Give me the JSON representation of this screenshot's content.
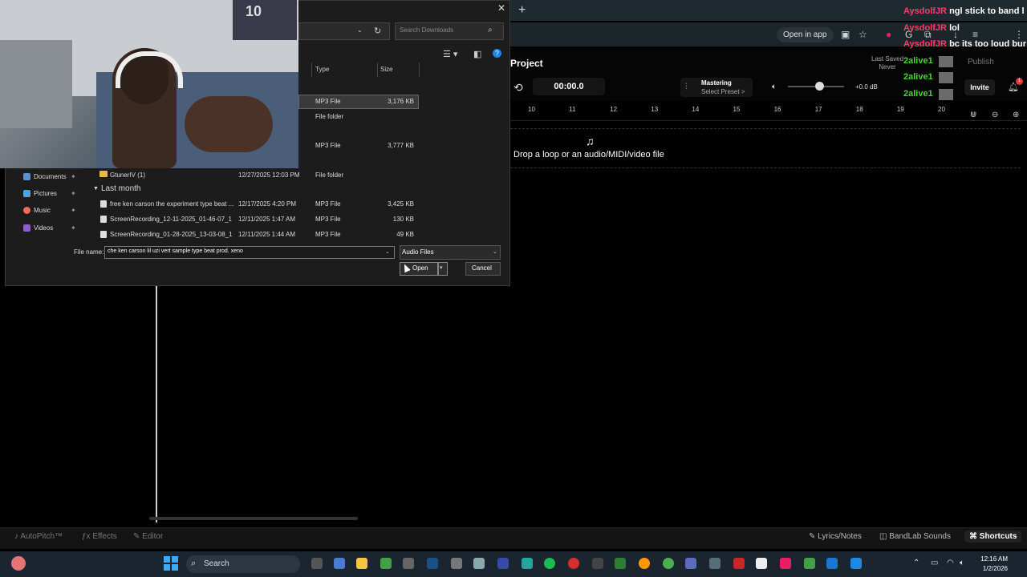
{
  "browser": {
    "new_tab": "+",
    "open_in_app": "Open in app"
  },
  "app": {
    "project_title": "Project",
    "last_saved_label": "Last Saved",
    "last_saved_value": "Never",
    "publish": "Publish",
    "time": "00:00.0",
    "mastering_title": "Mastering",
    "mastering_preset": "Select Preset >",
    "volume_level": 0.55,
    "db": "+0.0 dB",
    "invite": "Invite",
    "notifications": "1",
    "ruler": [
      "10",
      "11",
      "12",
      "13",
      "14",
      "15",
      "16",
      "17",
      "18",
      "19",
      "20"
    ],
    "drop_text": "Drop a loop or an audio/MIDI/video file"
  },
  "bottom_toolbar": {
    "autopitch": "AutoPitch™",
    "effects": "Effects",
    "editor": "Editor",
    "lyrics": "Lyrics/Notes",
    "sounds": "BandLab Sounds",
    "shortcuts": "Shortcuts"
  },
  "taskbar": {
    "search": "Search",
    "time": "12:16 AM",
    "date": "1/2/2026"
  },
  "dialog": {
    "search_placeholder": "Search Downloads",
    "columns": {
      "type": "Type",
      "size": "Size"
    },
    "top_rows": [
      {
        "type": "MP3 File",
        "size": "3,176 KB"
      },
      {
        "type": "File folder",
        "size": ""
      },
      {
        "type": "MP3 File",
        "size": "3,777 KB"
      }
    ],
    "folder_row": {
      "name": "GtunerIV (1)",
      "date": "12/27/2025 12:03 PM",
      "type": "File folder"
    },
    "group_label": "Last month",
    "rows": [
      {
        "name": "free ken carson the experiment type beat ...",
        "date": "12/17/2025 4:20 PM",
        "type": "MP3 File",
        "size": "3,425 KB"
      },
      {
        "name": "ScreenRecording_12-11-2025_01-46-07_1",
        "date": "12/11/2025 1:47 AM",
        "type": "MP3 File",
        "size": "130 KB"
      },
      {
        "name": "ScreenRecording_01-28-2025_13-03-08_1",
        "date": "12/11/2025 1:44 AM",
        "type": "MP3 File",
        "size": "49 KB"
      }
    ],
    "nav": [
      "Documents",
      "Pictures",
      "Music",
      "Videos"
    ],
    "filename_label": "File name:",
    "filename_value": "che ken carson lil uzi vert sample type beat prod. xeno",
    "filter": "Audio Files",
    "open": "Open",
    "cancel": "Cancel"
  },
  "webcam": {
    "jersey_number": "10"
  },
  "chat": [
    {
      "user": "AysdolfJR",
      "message": "ngl stick to band l"
    },
    {
      "user": "AysdolfJR",
      "message": "lol"
    },
    {
      "user": "AysdolfJR",
      "message": "bc its too loud bur"
    },
    {
      "user": "2alive1",
      "message": ""
    },
    {
      "user": "2alive1",
      "message": ""
    },
    {
      "user": "2alive1",
      "message": ""
    }
  ],
  "colors": {
    "accent_chat_user": "#ff3b6b",
    "accent_chat_user2": "#4cd137",
    "folder": "#e8b64a",
    "help": "#1e88e5"
  }
}
